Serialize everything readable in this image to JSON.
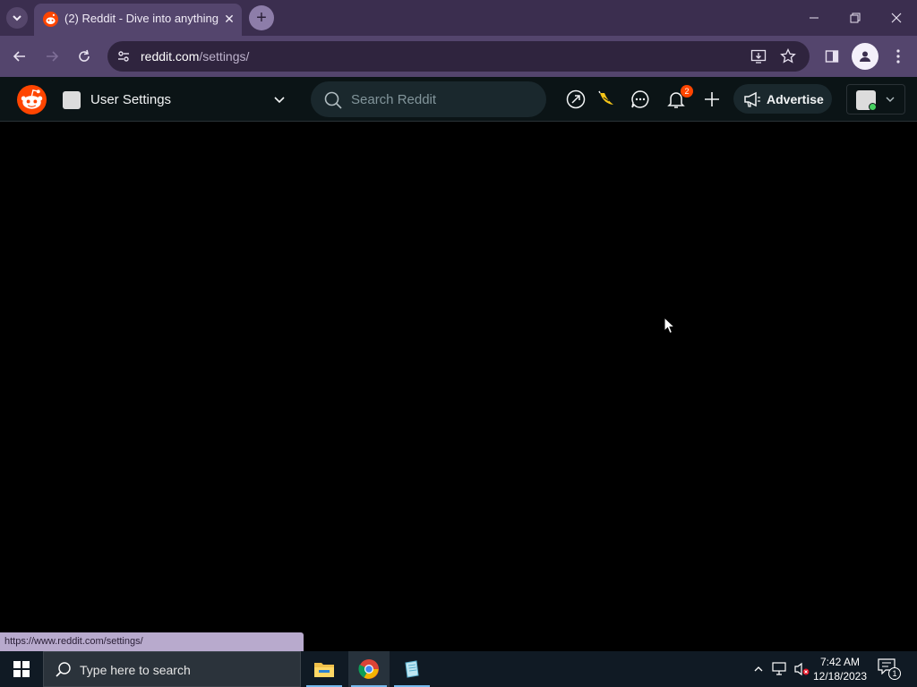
{
  "browser": {
    "tab": {
      "title": "(2) Reddit - Dive into anything",
      "favicon": "reddit-logo-icon",
      "close_glyph": "✕"
    },
    "new_tab_glyph": "+",
    "url_host": "reddit.com",
    "url_path": "/settings/",
    "window_controls": [
      "minimize",
      "restore",
      "close"
    ],
    "accent": "#3b2e4f"
  },
  "reddit": {
    "page_menu_label": "User Settings",
    "search_placeholder": "Search Reddit",
    "notifications_count": "2",
    "advertise_label": "Advertise",
    "brand_color": "#ff4500"
  },
  "status_bar_url": "https://www.reddit.com/settings/",
  "taskbar": {
    "search_placeholder": "Type here to search",
    "apps": [
      "file-explorer",
      "chrome",
      "notepad"
    ],
    "time": "7:42 AM",
    "date": "12/18/2023",
    "notifications": "1"
  }
}
